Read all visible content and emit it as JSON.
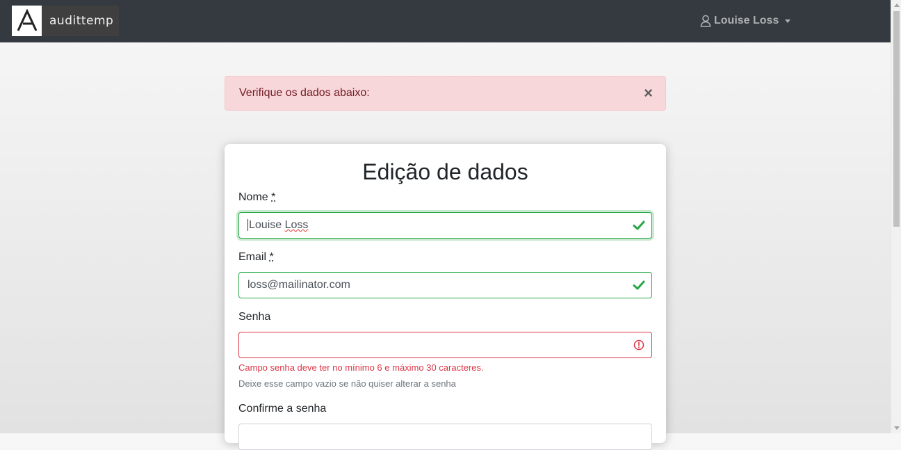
{
  "brand": {
    "name": "audittemp",
    "logo_letter": "A"
  },
  "user_menu": {
    "name": "Louise Loss",
    "icon": "user-icon"
  },
  "alert": {
    "message": "Verifique os dados abaixo:",
    "close_label": "×"
  },
  "form": {
    "title": "Edição de dados",
    "nome": {
      "label": "Nome",
      "required_marker": "*",
      "value_first": "Louise",
      "value_second": "Loss",
      "status": "valid"
    },
    "email": {
      "label": "Email",
      "required_marker": "*",
      "value": "loss@mailinator.com",
      "status": "valid"
    },
    "senha": {
      "label": "Senha",
      "value": "",
      "status": "invalid",
      "error": "Campo senha deve ter no mínimo 6 e máximo 30 caracteres.",
      "help": "Deixe esse campo vazio se não quiser alterar a senha"
    },
    "confirme": {
      "label": "Confirme a senha",
      "value": ""
    }
  },
  "colors": {
    "valid": "#28a745",
    "invalid": "#dc3545",
    "navbar": "#343a40",
    "alert_bg": "#f8d7da"
  }
}
